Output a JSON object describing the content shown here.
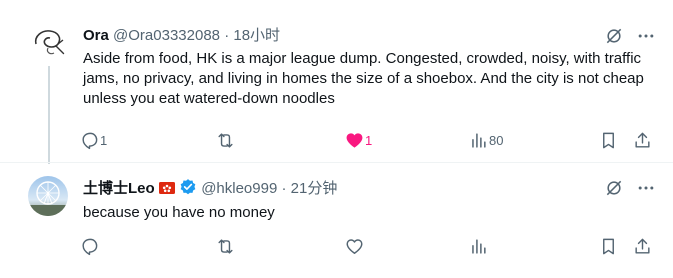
{
  "tweet1": {
    "display_name": "Ora",
    "handle": "@Ora03332088",
    "separator": "·",
    "time": "18小时",
    "text": "Aside from food, HK is a major league dump. Congested, crowded, noisy, with traffic jams, no privacy, and living in homes the size of a shoebox. And the city is not cheap unless you eat watered-down noodles",
    "reply_count": "1",
    "retweet_count": "",
    "like_count": "1",
    "liked": true,
    "view_count": "80"
  },
  "tweet2": {
    "display_name": "土博士Leo",
    "handle": "@hkleo999",
    "separator": "·",
    "time": "21分钟",
    "verified": true,
    "text": "because you have no money",
    "reply_count": "",
    "retweet_count": "",
    "like_count": "",
    "view_count": ""
  },
  "colors": {
    "text": "#0f1419",
    "secondary": "#536471",
    "like": "#f91880",
    "verified": "#1d9bf0",
    "hk_flag": "#de2910"
  }
}
